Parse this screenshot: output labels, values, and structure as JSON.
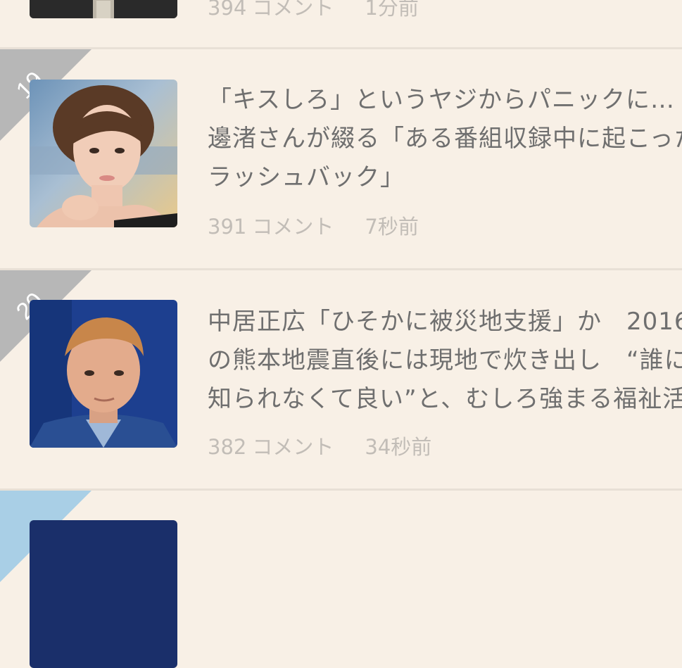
{
  "items": [
    {
      "comments": "394",
      "comment_unit": "コメント",
      "time": "1分前"
    },
    {
      "rank": "19",
      "title": "「キスしろ」というヤジからパニックに… 邊渚さんが綴る「ある番組収録中に起こった ラッシュバック」",
      "comments": "391",
      "comment_unit": "コメント",
      "time": "7秒前"
    },
    {
      "rank": "20",
      "title": "中居正広「ひそかに被災地支援」か　2016 の熊本地震直後には現地で炊き出し　“誰に 知られなくて良い”と、むしろ強まる福祉活",
      "comments": "382",
      "comment_unit": "コメント",
      "time": "34秒前"
    }
  ],
  "colors": {
    "background": "#f8f0e6",
    "ribbon_gray": "#b7b7b7",
    "ribbon_blue": "#a9cfe6",
    "title_text": "#6f6f6f",
    "meta_text": "#c2bdb7"
  }
}
